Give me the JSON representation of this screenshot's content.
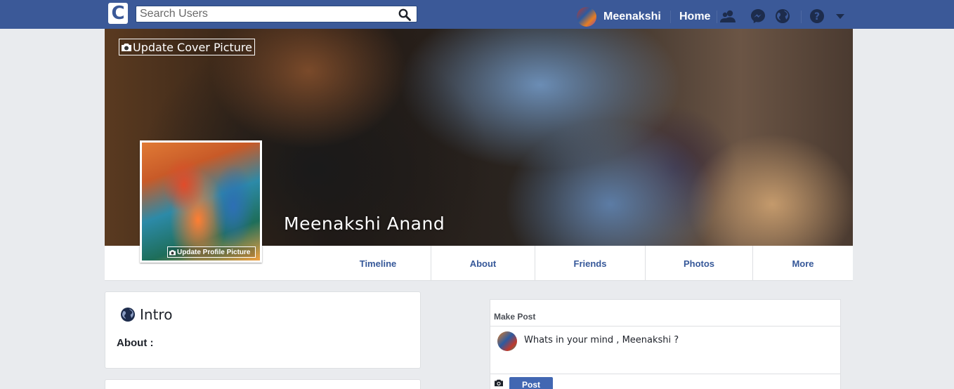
{
  "topbar": {
    "logo_letter": "C",
    "search_placeholder": "Search Users",
    "user_name": "Meenakshi",
    "home_label": "Home"
  },
  "cover": {
    "update_cover_label": "Update Cover Picture",
    "profile_name": "Meenakshi Anand",
    "update_profile_label": "Update Profile Picture"
  },
  "tabs": [
    {
      "label": "Timeline"
    },
    {
      "label": "About"
    },
    {
      "label": "Friends"
    },
    {
      "label": "Photos"
    },
    {
      "label": "More"
    }
  ],
  "intro": {
    "title": "Intro",
    "about_label": "About :"
  },
  "post": {
    "header": "Make Post",
    "prompt": "Whats in your mind , Meenakshi ?",
    "button_label": "Post"
  },
  "colors": {
    "brand": "#3b5998",
    "link": "#365899",
    "button": "#4267b2",
    "background": "#e9ebee"
  },
  "icons": [
    "search-icon",
    "friends-icon",
    "messenger-icon",
    "globe-icon",
    "help-icon",
    "chevron-down-icon",
    "camera-icon"
  ]
}
